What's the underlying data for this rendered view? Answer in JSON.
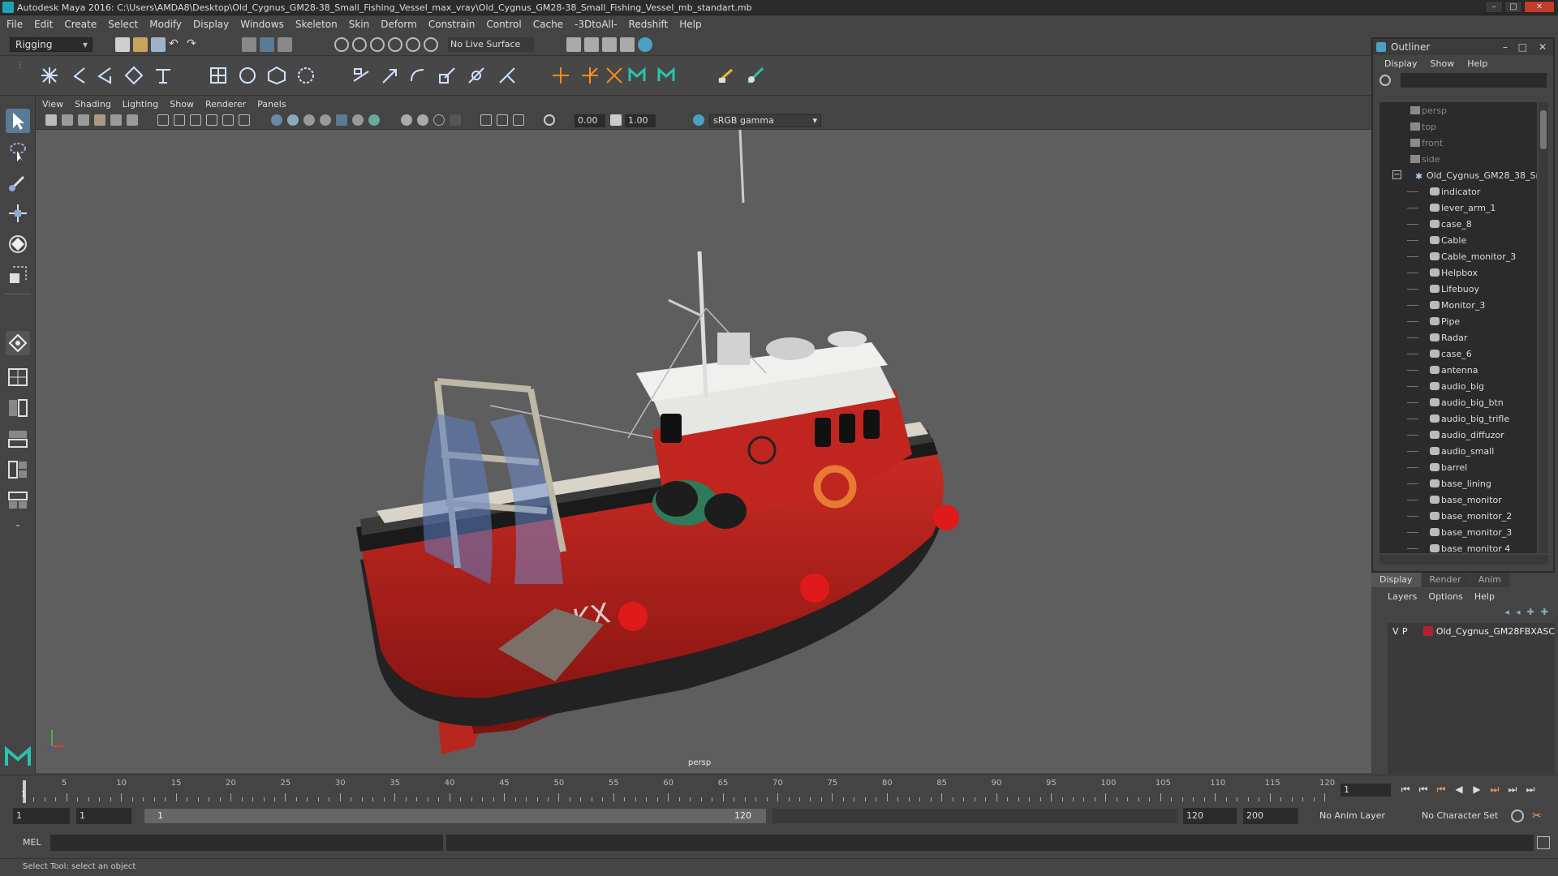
{
  "window": {
    "title": "Autodesk Maya 2016: C:\\Users\\AMDA8\\Desktop\\Old_Cygnus_GM28-38_Small_Fishing_Vessel_max_vray\\Old_Cygnus_GM28-38_Small_Fishing_Vessel_mb_standart.mb"
  },
  "menubar": [
    "File",
    "Edit",
    "Create",
    "Select",
    "Modify",
    "Display",
    "Windows",
    "Skeleton",
    "Skin",
    "Deform",
    "Constrain",
    "Control",
    "Cache",
    "-3DtoAll-",
    "Redshift",
    "Help"
  ],
  "statusline": {
    "mode": "Rigging",
    "live_surface": "No Live Surface"
  },
  "viewport": {
    "menu": [
      "View",
      "Shading",
      "Lighting",
      "Show",
      "Renderer",
      "Panels"
    ],
    "exposure": "0.00",
    "gamma": "1.00",
    "color_space": "sRGB gamma",
    "camera": "persp"
  },
  "outliner": {
    "title": "Outliner",
    "menu": [
      "Display",
      "Show",
      "Help"
    ],
    "cameras": [
      "persp",
      "top",
      "front",
      "side"
    ],
    "root": "Old_Cygnus_GM28_38_Sm",
    "children": [
      "indicator",
      "lever_arm_1",
      "case_8",
      "Cable",
      "Cable_monitor_3",
      "Helpbox",
      "Lifebuoy",
      "Monitor_3",
      "Pipe",
      "Radar",
      "case_6",
      "antenna",
      "audio_big",
      "audio_big_btn",
      "audio_big_trifle",
      "audio_diffuzor",
      "audio_small",
      "barrel",
      "base_lining",
      "base_monitor",
      "base_monitor_2",
      "base_monitor_3",
      "base_monitor 4"
    ]
  },
  "layers": {
    "tabs": [
      "Display",
      "Render",
      "Anim"
    ],
    "menu": [
      "Layers",
      "Options",
      "Help"
    ],
    "row": {
      "v": "V",
      "p": "P",
      "name": "Old_Cygnus_GM28FBXASC",
      "color": "#b52030"
    }
  },
  "timeline": {
    "ticks": [
      "5",
      "10",
      "15",
      "20",
      "25",
      "30",
      "35",
      "40",
      "45",
      "50",
      "55",
      "60",
      "65",
      "70",
      "75",
      "80",
      "85",
      "90",
      "95",
      "100",
      "105",
      "110",
      "115",
      "120"
    ],
    "start_marker": "1",
    "current_frame": "1"
  },
  "range": {
    "start": "1",
    "playback_start": "1",
    "slider_start": "1",
    "slider_end": "120",
    "playback_end": "120",
    "end": "200",
    "anim_layer": "No Anim Layer",
    "character_set": "No Character Set"
  },
  "command": {
    "label": "MEL"
  },
  "help": {
    "text": "Select Tool: select an object"
  }
}
